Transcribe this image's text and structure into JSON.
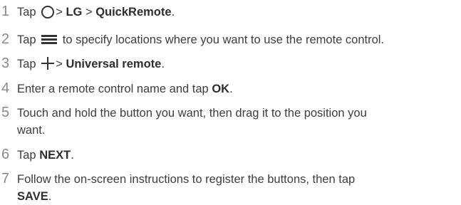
{
  "steps": [
    {
      "number": "1",
      "tap": "Tap",
      "sep1": ">",
      "lg": "LG",
      "sep2": ">",
      "app": "QuickRemote",
      "end": "."
    },
    {
      "number": "2",
      "tap": "Tap",
      "rest": "to specify locations where you want to use the remote control."
    },
    {
      "number": "3",
      "tap": "Tap",
      "sep1": ">",
      "option": "Universal remote",
      "end": "."
    },
    {
      "number": "4",
      "pre": "Enter a remote control name and tap ",
      "button": "OK",
      "end": "."
    },
    {
      "number": "5",
      "line1": "Touch and hold the button you want, then drag it to the position you",
      "line2": "want."
    },
    {
      "number": "6",
      "tap": "Tap ",
      "button": "NEXT",
      "end": "."
    },
    {
      "number": "7",
      "line1": "Follow the on-screen instructions to register the buttons, then tap",
      "button": "SAVE",
      "end": "."
    }
  ],
  "icons": {
    "home": "home-circle-icon",
    "menu": "menu-icon",
    "add": "plus-icon"
  }
}
